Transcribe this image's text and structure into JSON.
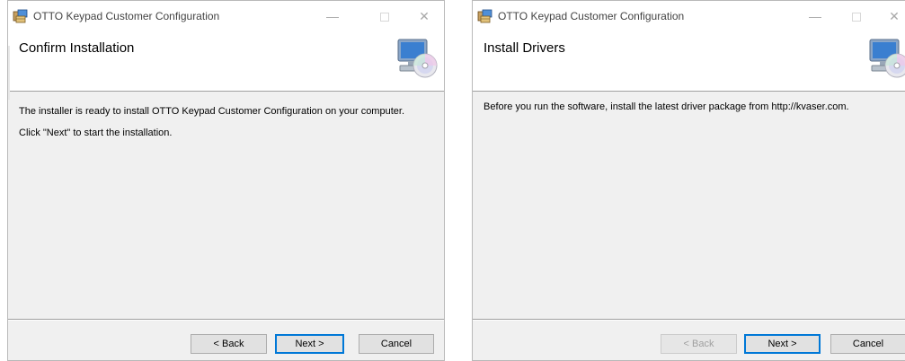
{
  "left_window": {
    "title": "OTTO Keypad Customer Configuration",
    "heading": "Confirm Installation",
    "body": [
      "The installer is ready to install OTTO Keypad Customer Configuration on your computer.",
      "Click \"Next\" to start the installation."
    ],
    "buttons": {
      "back": "< Back",
      "next": "Next >",
      "cancel": "Cancel"
    }
  },
  "right_window": {
    "title": "OTTO Keypad Customer Configuration",
    "heading": "Install Drivers",
    "body": [
      "Before you run the software, install the latest driver package from http://kvaser.com."
    ],
    "buttons": {
      "back": "< Back",
      "next": "Next >",
      "cancel": "Cancel"
    }
  },
  "window_controls": {
    "minimize": "—",
    "close": "✕"
  },
  "colors": {
    "default_button_border": "#0078d7",
    "banner_bg": "#ffffff",
    "dialog_bg": "#f0f0f0"
  },
  "icons": [
    "installer-app-icon",
    "computer-cd-icon"
  ]
}
